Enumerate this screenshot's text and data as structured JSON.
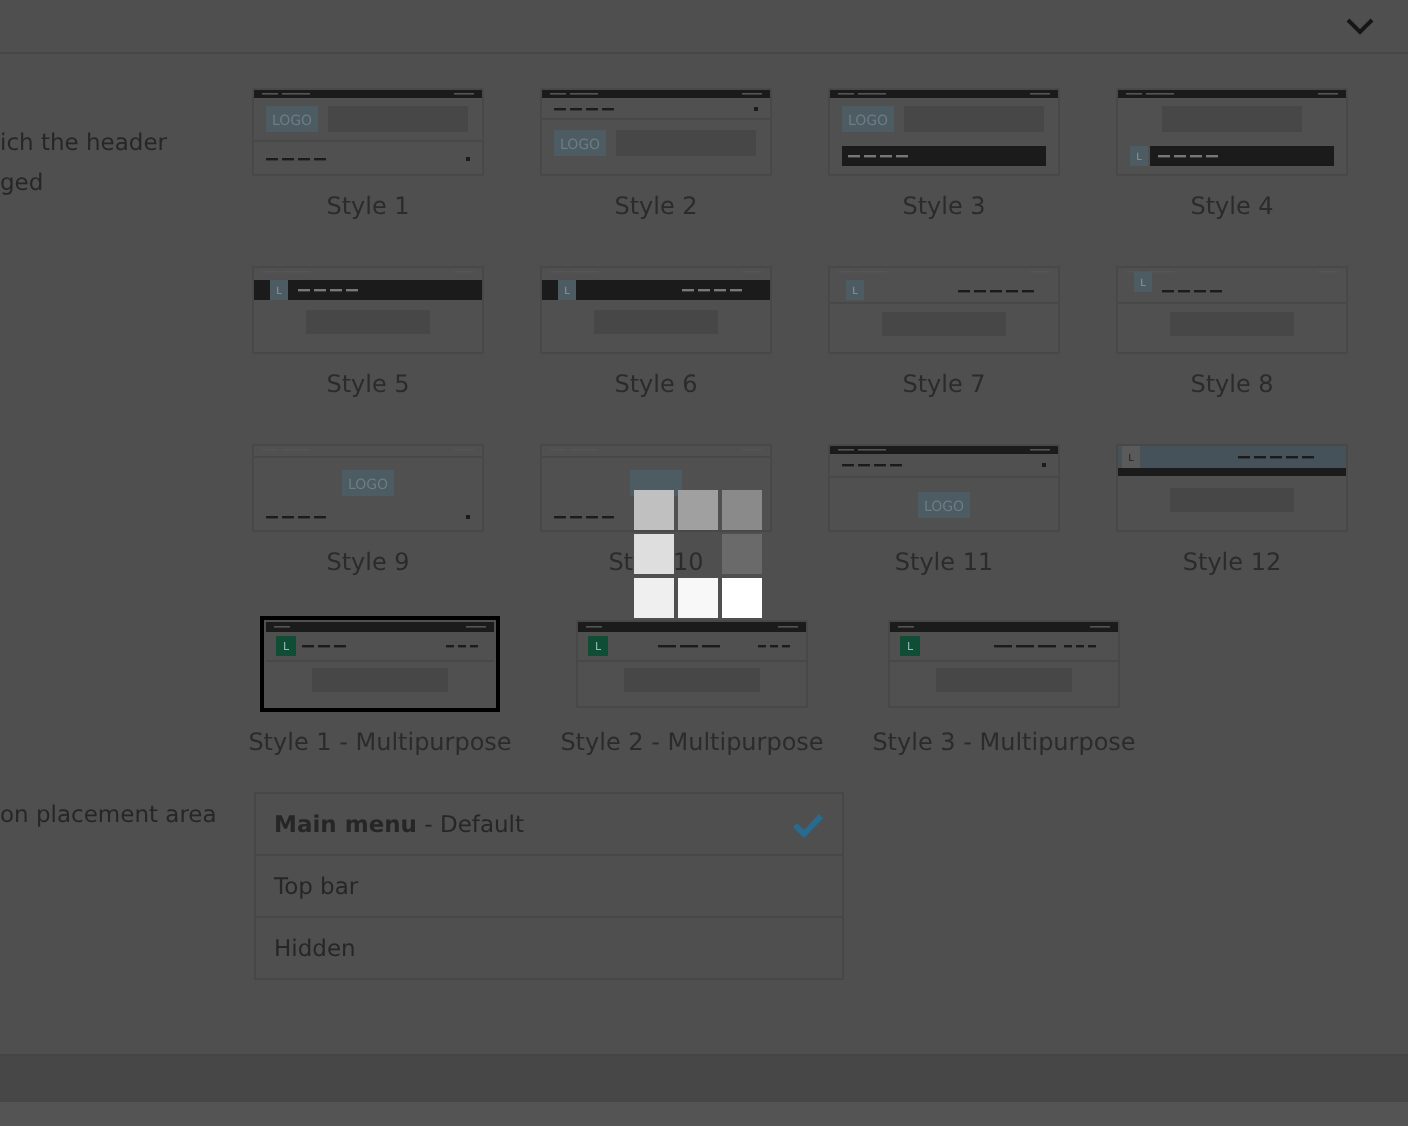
{
  "header_style": {
    "description_lines": [
      "ich the header",
      "ged"
    ],
    "styles": [
      {
        "label": "Style 1",
        "kind": "s1",
        "logo": "LOGO",
        "selected": false
      },
      {
        "label": "Style 2",
        "kind": "s2",
        "logo": "LOGO",
        "selected": false
      },
      {
        "label": "Style 3",
        "kind": "s3",
        "logo": "LOGO",
        "selected": false
      },
      {
        "label": "Style 4",
        "kind": "s4",
        "logo": "L",
        "selected": false
      },
      {
        "label": "Style 5",
        "kind": "s5",
        "logo": "L",
        "selected": false
      },
      {
        "label": "Style 6",
        "kind": "s6",
        "logo": "L",
        "selected": false
      },
      {
        "label": "Style 7",
        "kind": "s7",
        "logo": "L",
        "selected": false
      },
      {
        "label": "Style 8",
        "kind": "s8",
        "logo": "L",
        "selected": false
      },
      {
        "label": "Style 9",
        "kind": "s9",
        "logo": "LOGO",
        "selected": false
      },
      {
        "label": "St",
        "label_end": "10",
        "kind": "s9",
        "selected": false
      },
      {
        "label": "Style 11",
        "kind": "s11",
        "logo": "LOGO",
        "selected": false
      },
      {
        "label": "Style 12",
        "kind": "s12",
        "logo": "L",
        "selected": false
      }
    ],
    "multipurpose_styles": [
      {
        "label": "Style 1 - Multipurpose",
        "kind": "mp-left",
        "logo": "L",
        "selected": true
      },
      {
        "label": "Style 2 - Multipurpose",
        "kind": "mp-right",
        "logo": "L",
        "selected": false
      },
      {
        "label": "Style 3 - Multipurpose",
        "kind": "mp-wide",
        "logo": "L",
        "selected": false
      }
    ]
  },
  "menu_placement": {
    "description": "on placement area",
    "options": [
      {
        "label": "**Main menu** - Default",
        "selected": true
      },
      {
        "label": "Top bar",
        "selected": false
      },
      {
        "label": "Hidden",
        "selected": false
      }
    ]
  }
}
